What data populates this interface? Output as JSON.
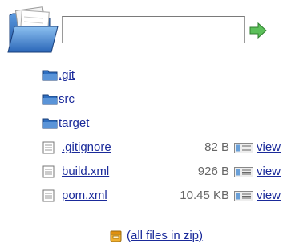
{
  "path_input": {
    "value": ""
  },
  "directories": [
    {
      "name": ".git"
    },
    {
      "name": "src"
    },
    {
      "name": "target"
    }
  ],
  "files": [
    {
      "name": ".gitignore",
      "size": "82 B",
      "view_label": "view"
    },
    {
      "name": "build.xml",
      "size": "926 B",
      "view_label": "view"
    },
    {
      "name": "pom.xml",
      "size": "10.45 KB",
      "view_label": "view"
    }
  ],
  "zip_link": {
    "label": "(all files in zip)"
  },
  "colors": {
    "link": "#1a2a9a",
    "folder": "#2f6fc0",
    "arrow": "#3ca33c"
  }
}
